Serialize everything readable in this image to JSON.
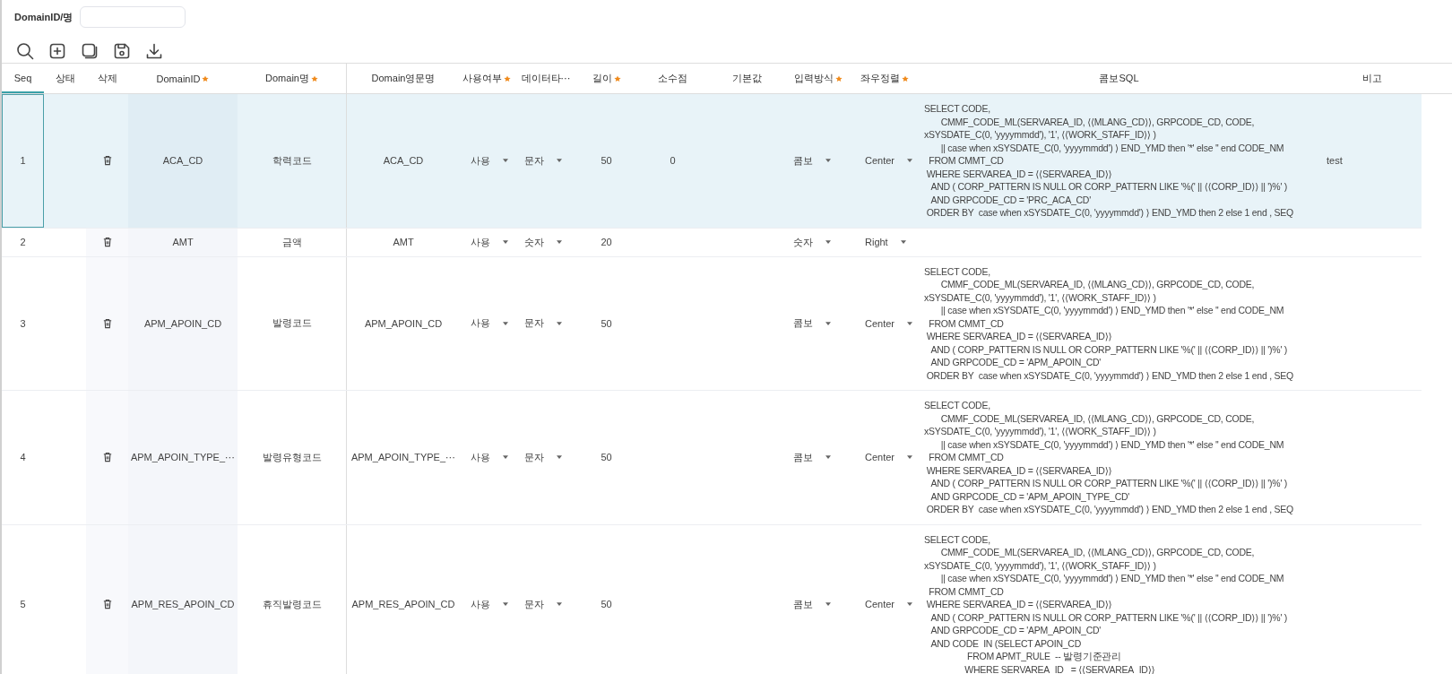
{
  "search": {
    "label": "DomainID/명"
  },
  "table": {
    "columns": [
      {
        "label": "Seq",
        "required": false
      },
      {
        "label": "상태",
        "required": false
      },
      {
        "label": "삭제",
        "required": false
      },
      {
        "label": "DomainID",
        "required": true
      },
      {
        "label": "Domain명",
        "required": true
      },
      {
        "label": "Domain영문명",
        "required": false
      },
      {
        "label": "사용여부",
        "required": true
      },
      {
        "label": "데이터타⋯",
        "required": false
      },
      {
        "label": "길이",
        "required": true
      },
      {
        "label": "소수점",
        "required": false
      },
      {
        "label": "기본값",
        "required": false
      },
      {
        "label": "입력방식",
        "required": true
      },
      {
        "label": "좌우정렬",
        "required": true
      },
      {
        "label": "콤보SQL",
        "required": false
      },
      {
        "label": "비고",
        "required": false
      }
    ],
    "rows": [
      {
        "seq": "1",
        "selected": true,
        "domain_id": "ACA_CD",
        "domain_name": "학력코드",
        "domain_en_name": "ACA_CD",
        "use": "사용",
        "data_type": "문자",
        "length": "50",
        "decimal": "0",
        "input_type": "콤보",
        "align": "Center",
        "combo_sql": [
          "SELECT CODE,",
          "       CMMF_CODE_ML(SERVAREA_ID, ⟨⟨MLANG_CD⟩⟩, GRPCODE_CD, CODE,",
          "xSYSDATE_C(0, 'yyyymmdd'), '1', ⟨⟨WORK_STAFF_ID⟩⟩ )",
          "       || case when xSYSDATE_C(0, 'yyyymmdd') ⟩ END_YMD then '*' else '' end CODE_NM",
          "  FROM CMMT_CD",
          " WHERE SERVAREA_ID = ⟨⟨SERVAREA_ID⟩⟩",
          "   AND ( CORP_PATTERN IS NULL OR CORP_PATTERN LIKE '%(' || ⟨⟨CORP_ID⟩⟩ || ')%' )",
          "   AND GRPCODE_CD = 'PRC_ACA_CD'",
          " ORDER BY  case when xSYSDATE_C(0, 'yyyymmdd') ⟩ END_YMD then 2 else 1 end , SEQ"
        ],
        "remark": "test"
      },
      {
        "seq": "2",
        "selected": false,
        "domain_id": "AMT",
        "domain_name": "금액",
        "domain_en_name": "AMT",
        "use": "사용",
        "data_type": "숫자",
        "length": "20",
        "input_type": "숫자",
        "align": "Right"
      },
      {
        "seq": "3",
        "selected": false,
        "domain_id": "APM_APOIN_CD",
        "domain_name": "발령코드",
        "domain_en_name": "APM_APOIN_CD",
        "use": "사용",
        "data_type": "문자",
        "length": "50",
        "input_type": "콤보",
        "align": "Center",
        "combo_sql": [
          "SELECT CODE,",
          "       CMMF_CODE_ML(SERVAREA_ID, ⟨⟨MLANG_CD⟩⟩, GRPCODE_CD, CODE,",
          "xSYSDATE_C(0, 'yyyymmdd'), '1', ⟨⟨WORK_STAFF_ID⟩⟩ )",
          "       || case when xSYSDATE_C(0, 'yyyymmdd') ⟩ END_YMD then '*' else '' end CODE_NM",
          "  FROM CMMT_CD",
          " WHERE SERVAREA_ID = ⟨⟨SERVAREA_ID⟩⟩",
          "   AND ( CORP_PATTERN IS NULL OR CORP_PATTERN LIKE '%(' || ⟨⟨CORP_ID⟩⟩ || ')%' )",
          "   AND GRPCODE_CD = 'APM_APOIN_CD'",
          " ORDER BY  case when xSYSDATE_C(0, 'yyyymmdd') ⟩ END_YMD then 2 else 1 end , SEQ"
        ]
      },
      {
        "seq": "4",
        "selected": false,
        "domain_id": "APM_APOIN_TYPE_⋯",
        "domain_name": "발령유형코드",
        "domain_en_name": "APM_APOIN_TYPE_⋯",
        "use": "사용",
        "data_type": "문자",
        "length": "50",
        "input_type": "콤보",
        "align": "Center",
        "combo_sql": [
          "SELECT CODE,",
          "       CMMF_CODE_ML(SERVAREA_ID, ⟨⟨MLANG_CD⟩⟩, GRPCODE_CD, CODE,",
          "xSYSDATE_C(0, 'yyyymmdd'), '1', ⟨⟨WORK_STAFF_ID⟩⟩ )",
          "       || case when xSYSDATE_C(0, 'yyyymmdd') ⟩ END_YMD then '*' else '' end CODE_NM",
          "  FROM CMMT_CD",
          " WHERE SERVAREA_ID = ⟨⟨SERVAREA_ID⟩⟩",
          "   AND ( CORP_PATTERN IS NULL OR CORP_PATTERN LIKE '%(' || ⟨⟨CORP_ID⟩⟩ || ')%' )",
          "   AND GRPCODE_CD = 'APM_APOIN_TYPE_CD'",
          " ORDER BY  case when xSYSDATE_C(0, 'yyyymmdd') ⟩ END_YMD then 2 else 1 end , SEQ"
        ]
      },
      {
        "seq": "5",
        "selected": false,
        "domain_id": "APM_RES_APOIN_CD",
        "domain_name": "휴직발령코드",
        "domain_en_name": "APM_RES_APOIN_CD",
        "use": "사용",
        "data_type": "문자",
        "length": "50",
        "input_type": "콤보",
        "align": "Center",
        "combo_sql": [
          "SELECT CODE,",
          "       CMMF_CODE_ML(SERVAREA_ID, ⟨⟨MLANG_CD⟩⟩, GRPCODE_CD, CODE,",
          "xSYSDATE_C(0, 'yyyymmdd'), '1', ⟨⟨WORK_STAFF_ID⟩⟩ )",
          "       || case when xSYSDATE_C(0, 'yyyymmdd') ⟩ END_YMD then '*' else '' end CODE_NM",
          "  FROM CMMT_CD",
          " WHERE SERVAREA_ID = ⟨⟨SERVAREA_ID⟩⟩",
          "   AND ( CORP_PATTERN IS NULL OR CORP_PATTERN LIKE '%(' || ⟨⟨CORP_ID⟩⟩ || ')%' )",
          "   AND GRPCODE_CD = 'APM_APOIN_CD'",
          "   AND CODE  IN (SELECT APOIN_CD",
          "                  FROM APMT_RULE  -- 발령기준관리",
          "                 WHERE SERVAREA_ID   = ⟨⟨SERVAREA_ID⟩⟩"
        ]
      }
    ]
  }
}
